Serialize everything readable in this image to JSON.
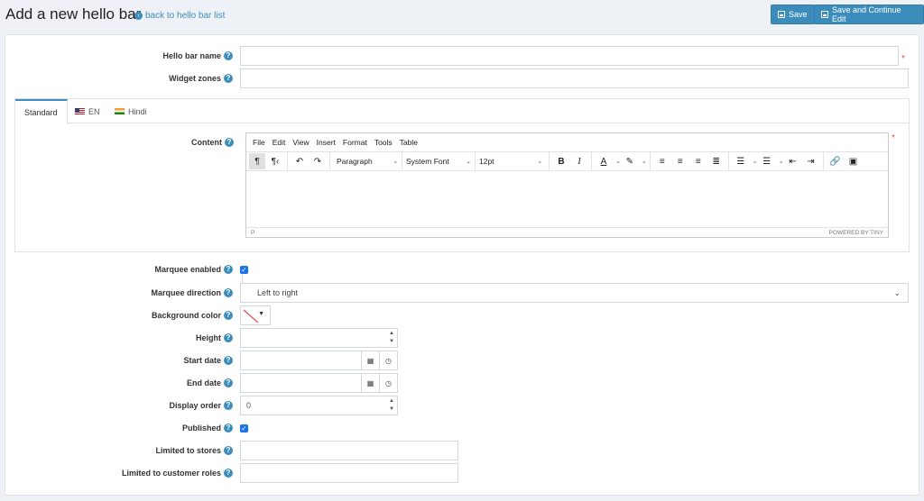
{
  "header": {
    "title": "Add a new hello bar",
    "back_link": "back to hello bar list",
    "save": "Save",
    "save_continue": "Save and Continue Edit"
  },
  "fields": {
    "hello_bar_name": {
      "label": "Hello bar name",
      "value": "",
      "required": "*"
    },
    "widget_zones": {
      "label": "Widget zones",
      "value": ""
    },
    "content": {
      "label": "Content",
      "required": "*"
    },
    "marquee_enabled": {
      "label": "Marquee enabled",
      "checked": true
    },
    "marquee_direction": {
      "label": "Marquee direction",
      "value": "Left to right"
    },
    "background_color": {
      "label": "Background color"
    },
    "height": {
      "label": "Height",
      "value": ""
    },
    "start_date": {
      "label": "Start date",
      "value": ""
    },
    "end_date": {
      "label": "End date",
      "value": ""
    },
    "display_order": {
      "label": "Display order",
      "value": "0"
    },
    "published": {
      "label": "Published",
      "checked": true
    },
    "limited_stores": {
      "label": "Limited to stores",
      "value": ""
    },
    "limited_roles": {
      "label": "Limited to customer roles",
      "value": ""
    }
  },
  "tabs": [
    {
      "label": "Standard",
      "flag": ""
    },
    {
      "label": "EN",
      "flag": "us-flag-icon"
    },
    {
      "label": "Hindi",
      "flag": "india-flag-icon"
    }
  ],
  "editor": {
    "menu": [
      "File",
      "Edit",
      "View",
      "Insert",
      "Format",
      "Tools",
      "Table"
    ],
    "block_format": "Paragraph",
    "font_family": "System Font",
    "font_size": "12pt",
    "status_path": "P",
    "branding": "POWERED BY TINY"
  },
  "colors": {
    "accent": "#3c8dbc",
    "checkbox": "#1a73e8",
    "required": "#d9534f"
  }
}
